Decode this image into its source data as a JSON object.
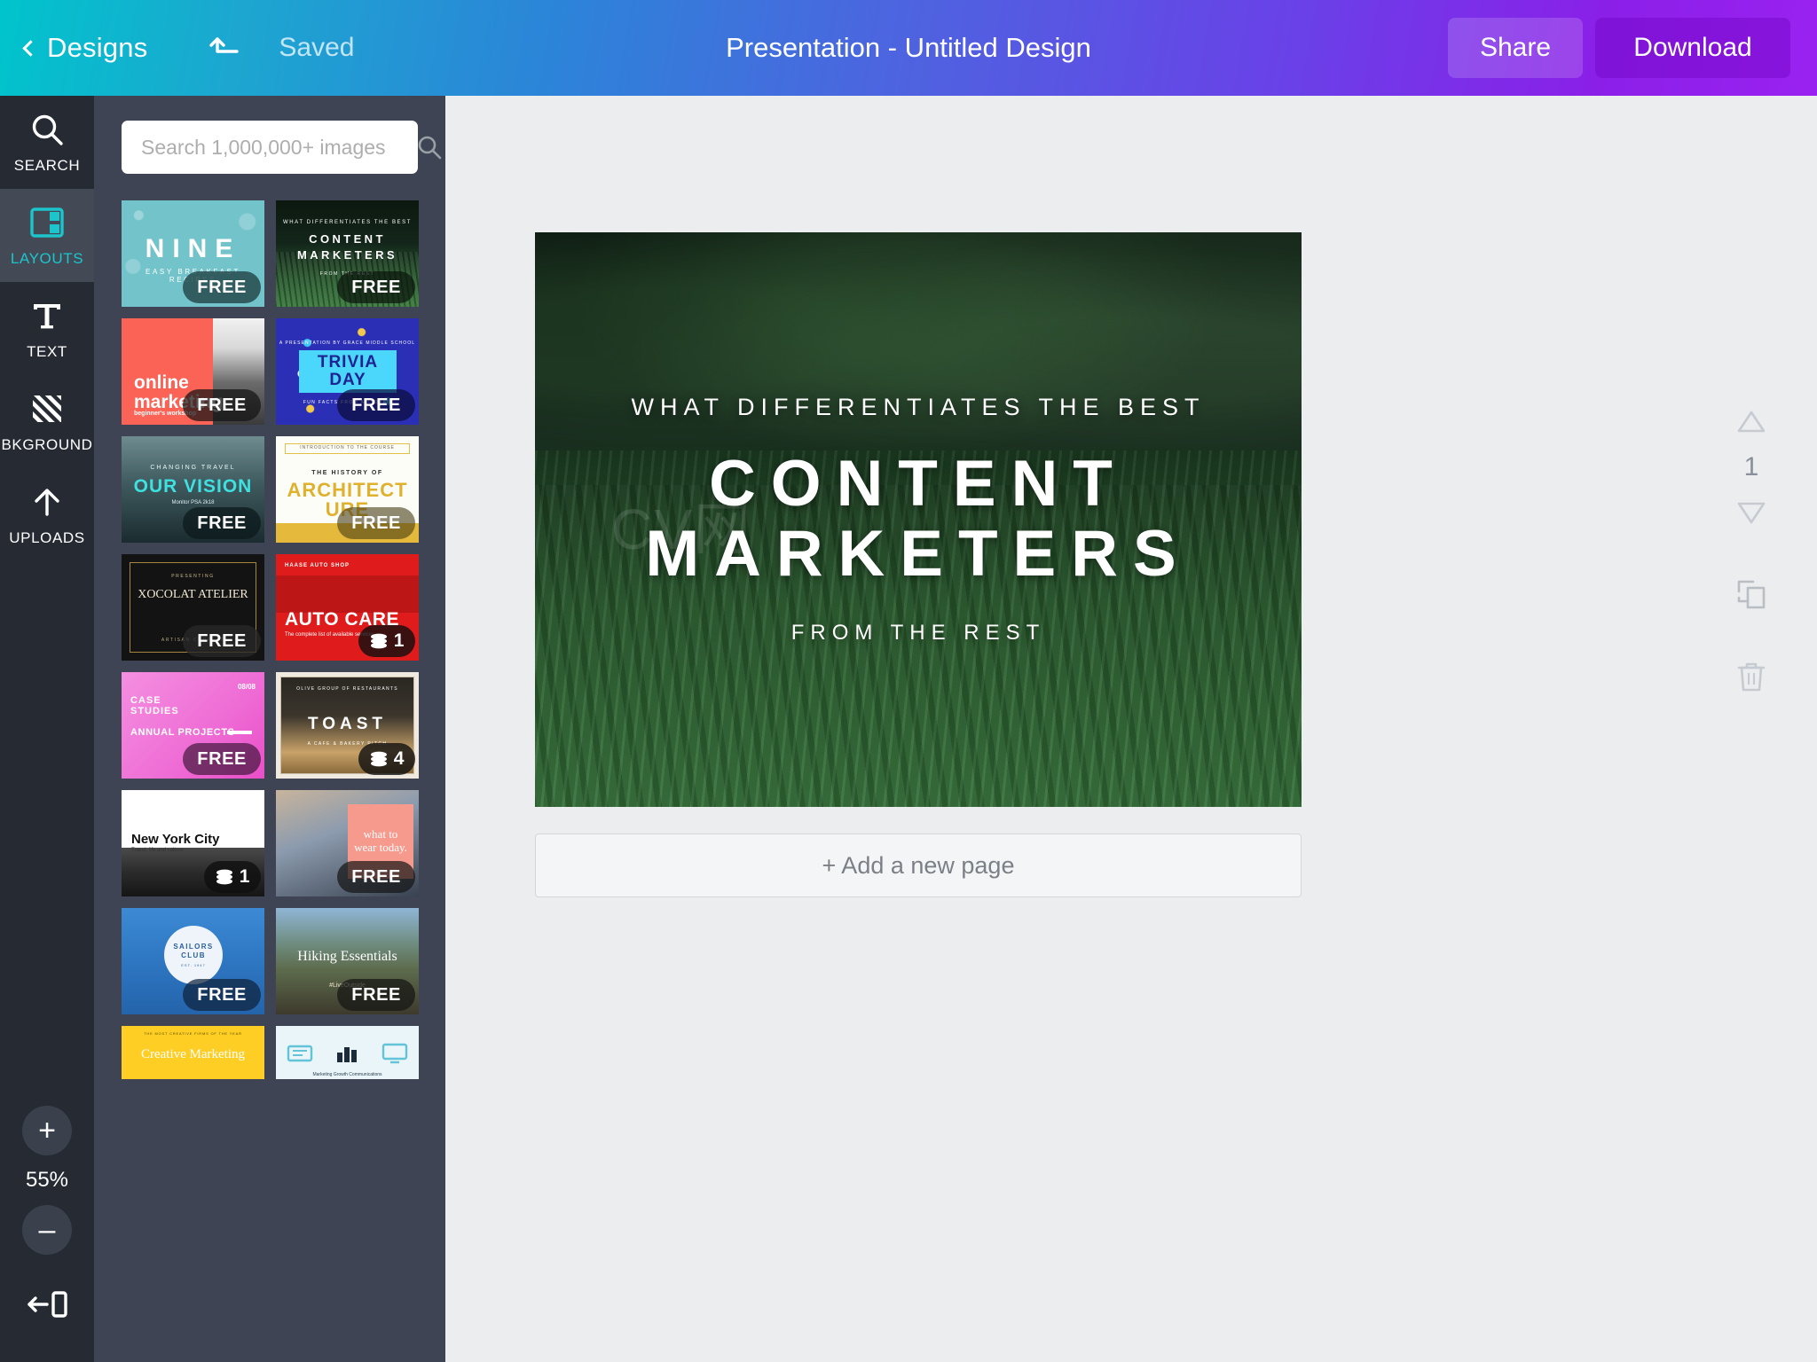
{
  "header": {
    "back_label": "Designs",
    "undo_icon": "undo-arrow-icon",
    "saved_label": "Saved",
    "title": "Presentation - Untitled Design",
    "share_label": "Share",
    "download_label": "Download"
  },
  "rail": {
    "items": [
      {
        "label": "SEARCH",
        "icon": "search-icon",
        "active": false
      },
      {
        "label": "LAYOUTS",
        "icon": "layouts-icon",
        "active": true
      },
      {
        "label": "TEXT",
        "icon": "text-icon",
        "active": false
      },
      {
        "label": "BKGROUND",
        "icon": "background-icon",
        "active": false
      },
      {
        "label": "UPLOADS",
        "icon": "upload-arrow-icon",
        "active": false
      }
    ],
    "zoom_in_label": "+",
    "zoom_level": "55%",
    "zoom_out_label": "–",
    "collapse_icon": "collapse-panel-icon"
  },
  "panel": {
    "search_placeholder": "Search 1,000,000+ images",
    "search_value": "",
    "search_icon": "search-icon",
    "thumbs": [
      {
        "name": "nine-breakfast-recipes",
        "title": "NINE",
        "subtitle": "EASY BREAKFAST RECIPES",
        "badge": "FREE",
        "badge_type": "free"
      },
      {
        "name": "content-marketers",
        "title": "CONTENT MARKETERS",
        "subtitle": "WHAT DIFFERENTIATES THE BEST",
        "footer": "FROM THE REST",
        "badge": "FREE",
        "badge_type": "free"
      },
      {
        "name": "online-marketing",
        "title": "online marketing",
        "subtitle": "beginner's workshop",
        "badge": "FREE",
        "badge_type": "free"
      },
      {
        "name": "trivia-day",
        "title": "TRIVIA DAY",
        "subtitle": "A PRESENTATION BY GRACE MIDDLE SCHOOL",
        "footer": "FUN FACTS FROM ALL OVER",
        "badge": "FREE",
        "badge_type": "free"
      },
      {
        "name": "our-vision",
        "title": "OUR VISION",
        "subtitle": "CHANGING TRAVEL",
        "footer": "Monitor PSA 2k18",
        "badge": "FREE",
        "badge_type": "free"
      },
      {
        "name": "history-of-architecture",
        "title": "ARCHITECTURE",
        "subtitle": "THE HISTORY OF",
        "footer": "INTRODUCTION TO THE COURSE",
        "badge": "FREE",
        "badge_type": "free"
      },
      {
        "name": "xocolat-atelier",
        "title": "XOCOLAT ATELIER",
        "subtitle": "PRESENTING",
        "footer": "ARTISAN CONFECT",
        "badge": "FREE",
        "badge_type": "free"
      },
      {
        "name": "auto-care",
        "title": "AUTO CARE",
        "subtitle": "HAASE AUTO SHOP",
        "footer": "The complete list of available services",
        "badge": "1",
        "badge_type": "stack"
      },
      {
        "name": "case-studies",
        "title": "CASE STUDIES",
        "subtitle": "ANNUAL PROJECTS",
        "footer": "08/08",
        "badge": "FREE",
        "badge_type": "free"
      },
      {
        "name": "toast-restaurants",
        "title": "TOAST",
        "subtitle": "OLIVE GROUP OF RESTAURANTS",
        "footer": "A CAFE & BAKERY PITCH",
        "badge": "4",
        "badge_type": "stack"
      },
      {
        "name": "new-york-city",
        "title": "New York City",
        "subtitle": "Travel, life and culture",
        "badge": "1",
        "badge_type": "stack"
      },
      {
        "name": "what-to-wear-today",
        "title": "what to wear today.",
        "badge": "FREE",
        "badge_type": "free"
      },
      {
        "name": "sailors-club",
        "title": "SAILORS CLUB",
        "subtitle": "EST. 1947",
        "badge": "FREE",
        "badge_type": "free"
      },
      {
        "name": "hiking-essentials",
        "title": "Hiking Essentials",
        "subtitle": "#LiveOutside",
        "badge": "FREE",
        "badge_type": "free"
      },
      {
        "name": "creative-marketing",
        "title": "Creative Marketing",
        "subtitle": "THE MOST CREATIVE FIRMS OF THE YEAR",
        "badge": "",
        "badge_type": "none"
      },
      {
        "name": "marketing-growth-comms",
        "title": "Marketing  Growth  Communications",
        "badge": "",
        "badge_type": "none"
      }
    ]
  },
  "canvas": {
    "slide": {
      "eyebrow": "WHAT DIFFERENTIATES THE BEST",
      "line1": "CONTENT",
      "line2": "MARKETERS",
      "subline": "FROM THE REST",
      "watermark": "CV网"
    },
    "add_page_label": "+ Add a new page",
    "page_tools": {
      "move_up_icon": "triangle-up-icon",
      "page_number": "1",
      "move_down_icon": "triangle-down-icon",
      "duplicate_icon": "copy-icon",
      "delete_icon": "trash-icon"
    }
  },
  "colors": {
    "header_start": "#00c4cc",
    "header_end": "#9a22f0",
    "rail_bg": "#252a33",
    "rail_active": "#434a56",
    "accent_teal": "#1cc5cc",
    "panel_bg": "#3e4453",
    "canvas_bg": "#ebedef"
  }
}
